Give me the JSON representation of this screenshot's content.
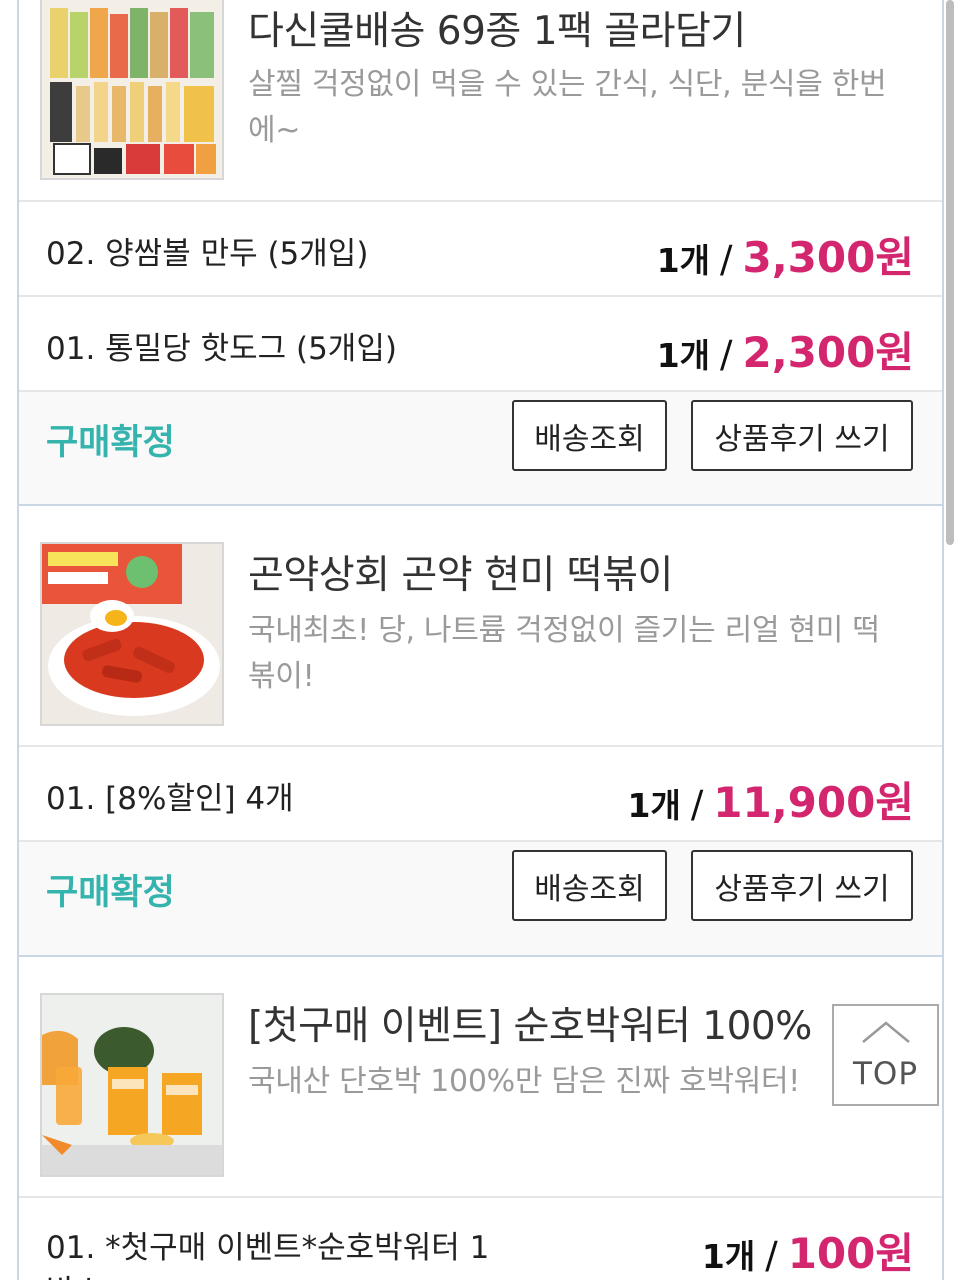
{
  "orders": [
    {
      "product": {
        "title": "다신쿨배송 69종 1팩 골라담기",
        "desc": "살찔 걱정없이 먹을 수 있는 간식, 식단, 분식을 한번에~",
        "thumb_icon": "snack-variety-pack-image"
      },
      "options": [
        {
          "name": "02. 양쌈볼 만두 (5개입)",
          "qty": "1개",
          "price": "3,300원"
        },
        {
          "name": "01. 통밀당 핫도그 (5개입)",
          "qty": "1개",
          "price": "2,300원"
        }
      ],
      "status": "구매확정",
      "track_label": "배송조회",
      "review_label": "상품후기 쓰기"
    },
    {
      "product": {
        "title": "곤약상회 곤약 현미 떡볶이",
        "desc": "국내최초! 당, 나트륨 걱정없이 즐기는 리얼 현미 떡볶이!",
        "thumb_icon": "tteokbokki-bowl-image"
      },
      "options": [
        {
          "name": "01. [8%할인] 4개",
          "qty": "1개",
          "price": "11,900원"
        }
      ],
      "status": "구매확정",
      "track_label": "배송조회",
      "review_label": "상품후기 쓰기"
    },
    {
      "product": {
        "title": "[첫구매 이벤트] 순호박워터 100%",
        "desc": "국내산 단호박 100%만 담은 진짜 호박워터!",
        "thumb_icon": "pumpkin-water-image"
      },
      "options": [
        {
          "name": "01. *첫구매 이벤트*순호박워터 1",
          "name2": "박스",
          "qty": "1개",
          "price": "100원"
        }
      ]
    }
  ],
  "slash": "/",
  "top_button": {
    "label": "TOP",
    "icon": "chevron-up-icon"
  },
  "colors": {
    "price": "#d3266e",
    "status": "#35b3ad",
    "border": "#c9d6e3"
  }
}
